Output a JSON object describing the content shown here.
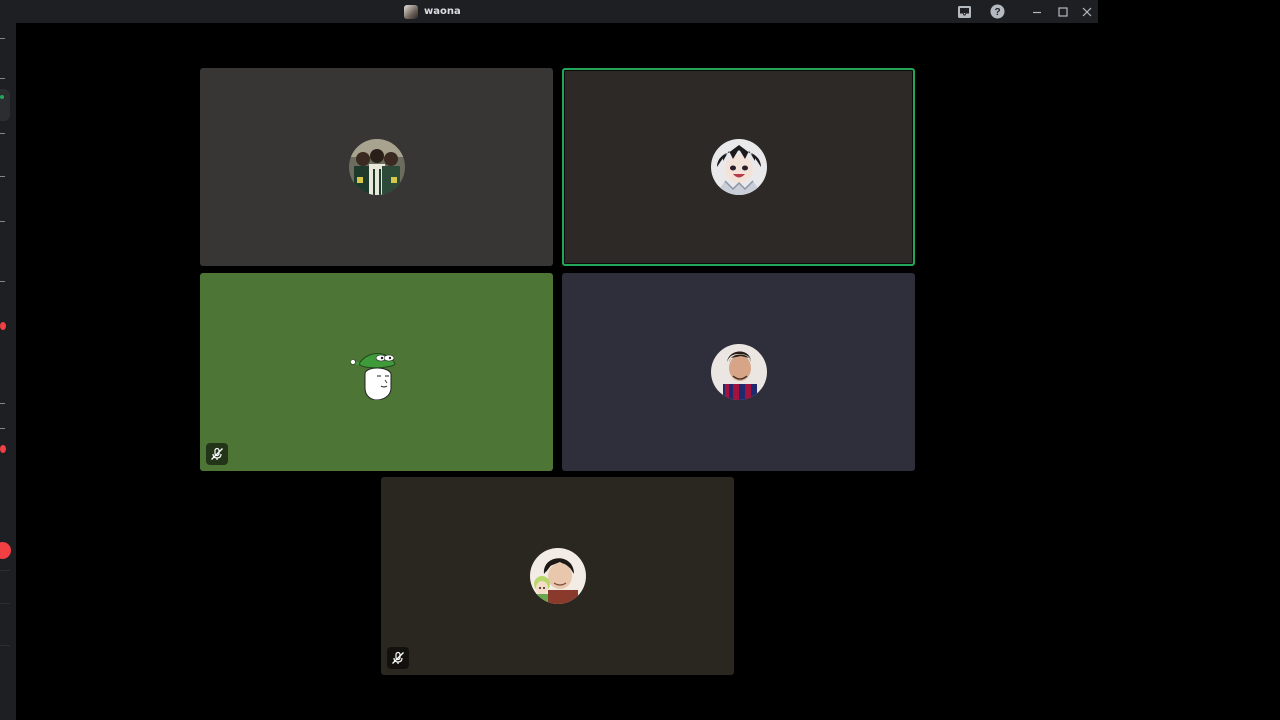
{
  "window": {
    "title": "waona",
    "controls": {
      "inbox_icon": "inbox-icon",
      "help_icon": "help-icon",
      "minimize_icon": "minimize-icon",
      "maximize_icon": "maximize-icon",
      "close_icon": "close-icon"
    }
  },
  "colors": {
    "speaking_ring": "#23a55a",
    "tile_1_bg": "#373634",
    "tile_2_bg": "#2c2927",
    "tile_3_bg": "#4d7536",
    "tile_4_bg": "#2f2f3c",
    "tile_5_bg": "#2a2620",
    "rail_alert": "#f23f43"
  },
  "participants": [
    {
      "avatar": "group-photo-avatar",
      "speaking": false,
      "muted": false
    },
    {
      "avatar": "anime-character-avatar",
      "speaking": true,
      "muted": false
    },
    {
      "avatar": "pepe-wojak-avatar",
      "speaking": false,
      "muted": true,
      "status_icon": "mic-muted-icon"
    },
    {
      "avatar": "footballer-avatar",
      "speaking": false,
      "muted": false
    },
    {
      "avatar": "selfie-avatar",
      "speaking": false,
      "muted": true,
      "status_icon": "mic-muted-icon"
    }
  ]
}
